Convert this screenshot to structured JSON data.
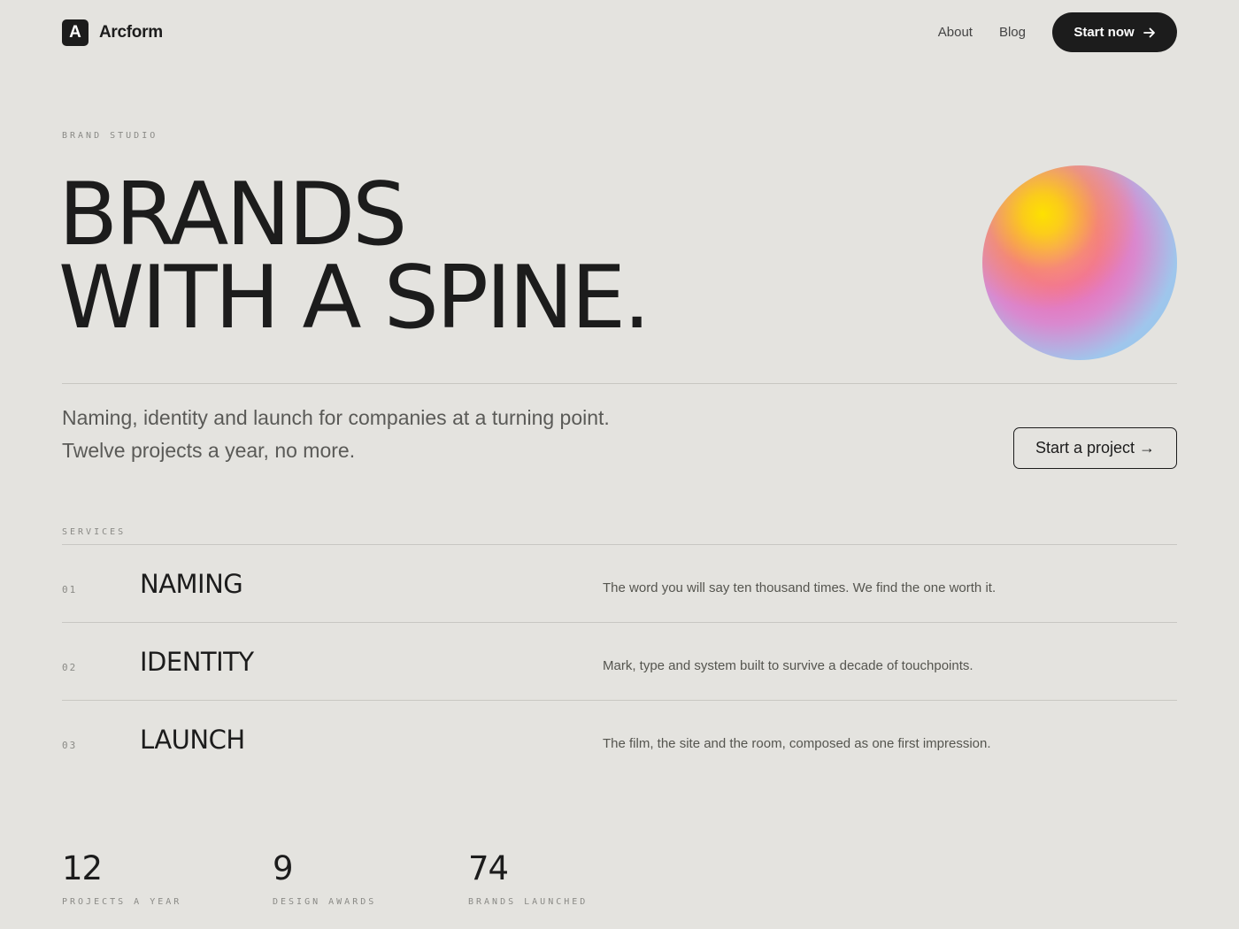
{
  "nav": {
    "logo_letter": "A",
    "brand_name": "Arcform",
    "links": [
      {
        "label": "About"
      },
      {
        "label": "Blog"
      }
    ],
    "cta_label": "Start now",
    "cta_icon": "arrow-right-icon"
  },
  "hero": {
    "eyebrow": "BRAND STUDIO",
    "headline_line1": "BRANDS",
    "headline_line2": "WITH A SPINE.",
    "intro_line1": "Naming, identity and launch for companies at a turning point.",
    "intro_line2": "Twelve projects a year, no more.",
    "cta_label": "Start a project →"
  },
  "services": {
    "label": "SERVICES",
    "items": [
      {
        "num": "01",
        "title": "NAMING",
        "desc": "The word you will say ten thousand times. We find the one worth it."
      },
      {
        "num": "02",
        "title": "IDENTITY",
        "desc": "Mark, type and system built to survive a decade of touchpoints."
      },
      {
        "num": "03",
        "title": "LAUNCH",
        "desc": "The film, the site and the room, composed as one first impression."
      }
    ]
  },
  "stats": [
    {
      "value": "12",
      "label": "PROJECTS A YEAR"
    },
    {
      "value": "9",
      "label": "DESIGN AWARDS"
    },
    {
      "value": "74",
      "label": "BRANDS LAUNCHED"
    }
  ],
  "colors": {
    "background": "#e4e3df",
    "ink": "#1c1c1c",
    "muted": "#8a8a86"
  }
}
